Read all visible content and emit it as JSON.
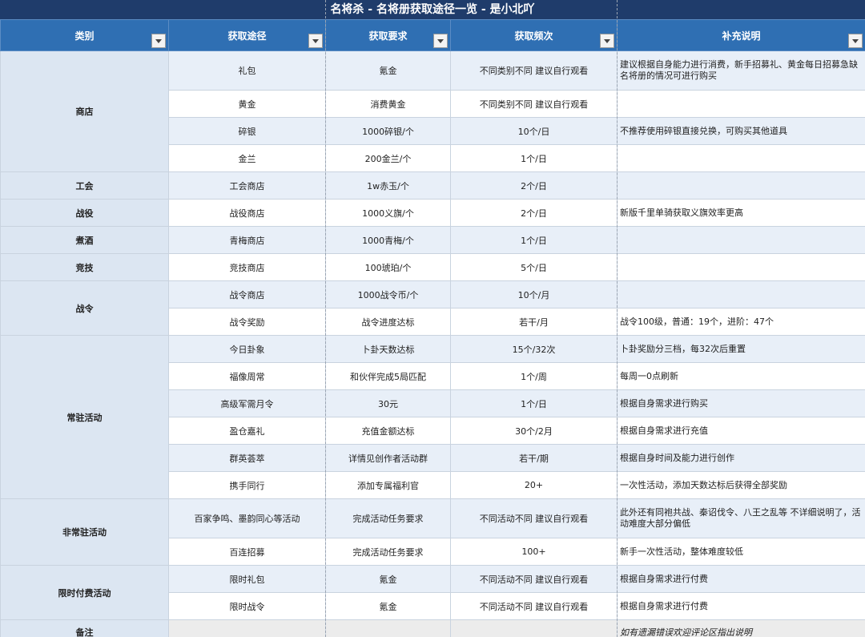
{
  "title": "名将杀 - 名将册获取途径一览 - 是小北吖",
  "headers": [
    "类别",
    "获取途径",
    "获取要求",
    "获取频次",
    "补充说明"
  ],
  "groups": [
    {
      "category": "商店",
      "rows": [
        {
          "way": "礼包",
          "req": "氪金",
          "freq": "不同类别不同 建议自行观看",
          "note": "建议根据自身能力进行消费，新手招募礼、黄金每日招募急缺名将册的情况可进行购买"
        },
        {
          "way": "黄金",
          "req": "消费黄金",
          "freq": "不同类别不同 建议自行观看",
          "note": ""
        },
        {
          "way": "碎银",
          "req": "1000碎银/个",
          "freq": "10个/日",
          "note": "不推荐使用碎银直接兑换，可购买其他道具"
        },
        {
          "way": "金兰",
          "req": "200金兰/个",
          "freq": "1个/日",
          "note": ""
        }
      ]
    },
    {
      "category": "工会",
      "rows": [
        {
          "way": "工会商店",
          "req": "1w赤玉/个",
          "freq": "2个/日",
          "note": ""
        }
      ]
    },
    {
      "category": "战役",
      "rows": [
        {
          "way": "战役商店",
          "req": "1000义旗/个",
          "freq": "2个/日",
          "note": "新版千里单骑获取义旗效率更高"
        }
      ]
    },
    {
      "category": "煮酒",
      "rows": [
        {
          "way": "青梅商店",
          "req": "1000青梅/个",
          "freq": "1个/日",
          "note": ""
        }
      ]
    },
    {
      "category": "竞技",
      "rows": [
        {
          "way": "竞技商店",
          "req": "100琥珀/个",
          "freq": "5个/日",
          "note": ""
        }
      ]
    },
    {
      "category": "战令",
      "rows": [
        {
          "way": "战令商店",
          "req": "1000战令币/个",
          "freq": "10个/月",
          "note": ""
        },
        {
          "way": "战令奖励",
          "req": "战令进度达标",
          "freq": "若干/月",
          "note": "战令100级，普通：19个，进阶：47个"
        }
      ]
    },
    {
      "category": "常驻活动",
      "rows": [
        {
          "way": "今日卦象",
          "req": "卜卦天数达标",
          "freq": "15个/32次",
          "note": "卜卦奖励分三档，每32次后重置"
        },
        {
          "way": "福像周常",
          "req": "和伙伴完成5局匹配",
          "freq": "1个/周",
          "note": "每周一0点刷新"
        },
        {
          "way": "高级军需月令",
          "req": "30元",
          "freq": "1个/日",
          "note": "根据自身需求进行购买"
        },
        {
          "way": "盈仓嘉礼",
          "req": "充值金额达标",
          "freq": "30个/2月",
          "note": "根据自身需求进行充值"
        },
        {
          "way": "群英荟萃",
          "req": "详情见创作者活动群",
          "freq": "若干/期",
          "note": "根据自身时间及能力进行创作"
        },
        {
          "way": "携手同行",
          "req": "添加专属福利官",
          "freq": "20+",
          "note": "一次性活动，添加天数达标后获得全部奖励"
        }
      ]
    },
    {
      "category": "非常驻活动",
      "rows": [
        {
          "way": "百家争鸣、墨韵同心等活动",
          "req": "完成活动任务要求",
          "freq": "不同活动不同 建议自行观看",
          "note": "此外还有同袍共战、秦诏伐令、八王之乱等 不详细说明了，活动难度大部分偏低"
        },
        {
          "way": "百连招募",
          "req": "完成活动任务要求",
          "freq": "100+",
          "note": "新手一次性活动，整体难度较低"
        }
      ]
    },
    {
      "category": "限时付费活动",
      "rows": [
        {
          "way": "限时礼包",
          "req": "氪金",
          "freq": "不同活动不同 建议自行观看",
          "note": "根据自身需求进行付费"
        },
        {
          "way": "限时战令",
          "req": "氪金",
          "freq": "不同活动不同 建议自行观看",
          "note": "根据自身需求进行付费"
        }
      ]
    }
  ],
  "remark": {
    "category": "备注",
    "note": "如有遗漏错误欢迎评论区指出说明"
  }
}
